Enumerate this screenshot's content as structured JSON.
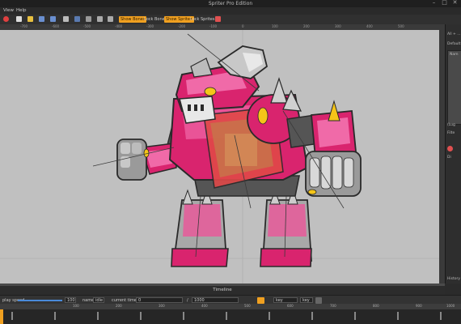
{
  "window": {
    "title": "Spriter Pro Edition",
    "controls": [
      "–",
      "□",
      "✕"
    ]
  },
  "menubar": {
    "items": [
      "View",
      "Help"
    ]
  },
  "toolbar": {
    "buttons": {
      "show_bones": "Show Bones",
      "lock_bones": "Lock Bones",
      "show_sprites": "Show Sprites",
      "lock_sprites": "Lock Sprites"
    }
  },
  "ruler": {
    "ticks": [
      "-700",
      "-600",
      "-500",
      "-400",
      "-300",
      "-200",
      "-100",
      "0",
      "100",
      "200",
      "300",
      "400",
      "500"
    ]
  },
  "sidebar": {
    "lines": [
      "All + ...",
      "Default",
      "Nam",
      "(Lug",
      "Filte",
      "Di"
    ],
    "bottom_label": "History"
  },
  "timeline": {
    "title": "Timeline",
    "play_speed_label": "play speed",
    "play_speed_value": "100",
    "name_label": "name",
    "name_value": "idle",
    "current_time_label": "current time",
    "current_time_value": "0",
    "separator": "/",
    "total_time_value": "1000",
    "key_selected_label": "key selected",
    "key_all_label": "key all",
    "ticks": [
      "100",
      "200",
      "300",
      "400",
      "500",
      "600",
      "700",
      "800",
      "900",
      "1000"
    ]
  },
  "colors": {
    "accent": "#f0a020",
    "armor_pink": "#d9246e",
    "armor_light": "#f06aa8",
    "metal": "#a8a8a8",
    "canvas_bg": "#c0c0c0"
  }
}
